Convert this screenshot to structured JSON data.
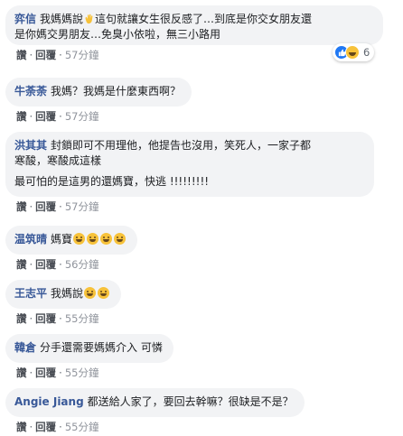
{
  "actions": {
    "like": "讚",
    "reply": "回覆",
    "sep": "·"
  },
  "reactions": {
    "count": "6",
    "types": [
      "like-icon",
      "haha-icon"
    ]
  },
  "comments": [
    {
      "author": "弈信",
      "text1": "我媽媽說",
      "text1b": "這句就讓女生很反感了…到底是你交女朋友還",
      "text2": "是你媽交男朋友…免臭小依啦，無三小路用",
      "time": "57分鐘"
    },
    {
      "author": "牛荼荼",
      "text1": "我媽？我媽是什麼東西啊？",
      "time": "57分鐘"
    },
    {
      "author": "洪其其",
      "text1": "封鎖即可不用理他，他提告也沒用，笑死人，一家子都",
      "text2": "寒酸，寒酸成這樣",
      "text3": "最可怕的是這男的還媽寶，快逃 !!!!!!!!!",
      "time": "57分鐘"
    },
    {
      "author": "温筑晴",
      "text1": "媽寶",
      "time": "56分鐘"
    },
    {
      "author": "王志平",
      "text1": "我媽說",
      "time": "55分鐘"
    },
    {
      "author": "韓倉",
      "text1": "分手還需要媽媽介入 可憐",
      "time": "55分鐘"
    },
    {
      "author": "Angie Jiang",
      "text1": "都送給人家了，要回去幹嘛？很缺是不是？",
      "time": "55分鐘"
    }
  ]
}
